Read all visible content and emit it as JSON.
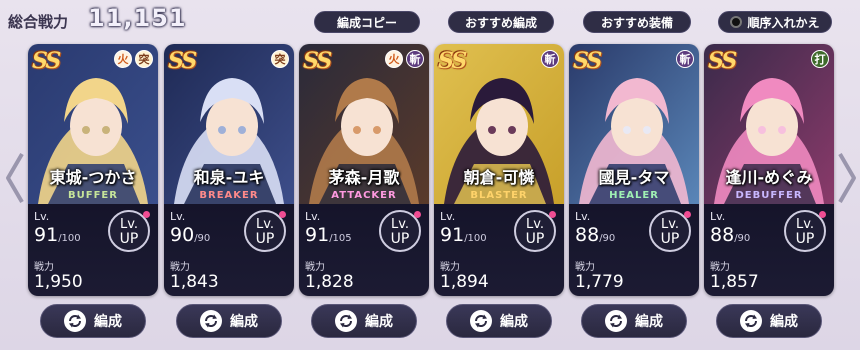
{
  "header": {
    "total_label": "総合戦力",
    "total_value": "11,151",
    "copy_button": "編成コピー",
    "recommend_formation": "おすすめ編成",
    "recommend_equipment": "おすすめ装備",
    "reorder": "順序入れかえ"
  },
  "labels": {
    "lv": "Lv.",
    "lvup_line1": "Lv.",
    "lvup_line2": "UP",
    "power": "戦力",
    "edit": "編成"
  },
  "cards": [
    {
      "rank": "SS",
      "attr1": "火",
      "attr2": "突",
      "name": "東城-つかさ",
      "role": "BUFFER",
      "role_color": "#c6e59a",
      "level": "91",
      "level_max": "/100",
      "power": "1,950"
    },
    {
      "rank": "SS",
      "attr1": "",
      "attr2": "突",
      "name": "和泉-ユキ",
      "role": "BREAKER",
      "role_color": "#ff8a8a",
      "level": "90",
      "level_max": "/90",
      "power": "1,843"
    },
    {
      "rank": "SS",
      "attr1": "火",
      "attr2": "斬",
      "name": "茅森-月歌",
      "role": "ATTACKER",
      "role_color": "#ff9ae0",
      "level": "91",
      "level_max": "/105",
      "power": "1,828"
    },
    {
      "rank": "SS",
      "attr1": "",
      "attr2": "斬",
      "name": "朝倉-可憐",
      "role": "BLASTER",
      "role_color": "#ffd36a",
      "level": "91",
      "level_max": "/100",
      "power": "1,894"
    },
    {
      "rank": "SS",
      "attr1": "",
      "attr2": "斬",
      "name": "國見-タマ",
      "role": "HEALER",
      "role_color": "#9ff0b4",
      "level": "88",
      "level_max": "/90",
      "power": "1,779"
    },
    {
      "rank": "SS",
      "attr1": "",
      "attr2": "打",
      "name": "逢川-めぐみ",
      "role": "DEBUFFER",
      "role_color": "#c9b8ff",
      "level": "88",
      "level_max": "/90",
      "power": "1,857"
    }
  ]
}
